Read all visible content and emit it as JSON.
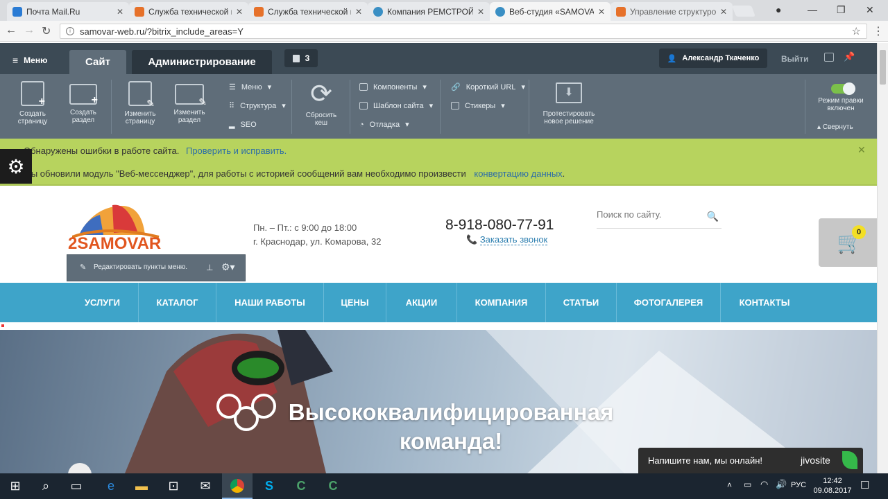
{
  "browser": {
    "tabs": [
      {
        "title": "Почта Mail.Ru",
        "color": "#2a7bd4"
      },
      {
        "title": "Служба технической п",
        "color": "#e6712a"
      },
      {
        "title": "Служба технической п",
        "color": "#e6712a"
      },
      {
        "title": "Компания РЕМСТРОЙ",
        "color": "#3a8fc4"
      },
      {
        "title": "Веб-студия «SAMOVAR",
        "color": "#3a8fc4"
      },
      {
        "title": "Управление структуро",
        "color": "#e6712a"
      }
    ],
    "url": "samovar-web.ru/?bitrix_include_areas=Y"
  },
  "bx": {
    "menu": "Меню",
    "tab_site": "Сайт",
    "tab_admin": "Администрирование",
    "notif_count": "3",
    "user": "Александр Ткаченко",
    "logout": "Выйти",
    "tools": {
      "create_page_1": "Создать",
      "create_page_2": "страницу",
      "create_section_1": "Создать",
      "create_section_2": "раздел",
      "edit_page_1": "Изменить",
      "edit_page_2": "страницу",
      "edit_section_1": "Изменить",
      "edit_section_2": "раздел",
      "menu": "Меню",
      "structure": "Структура",
      "seo": "SEO",
      "reset_1": "Сбросить",
      "reset_2": "кеш",
      "components": "Компоненты",
      "template": "Шаблон сайта",
      "debug": "Отладка",
      "short_url": "Короткий URL",
      "stickers": "Стикеры",
      "test_1": "Протестировать",
      "test_2": "новое решение",
      "edit_mode_1": "Режим правки",
      "edit_mode_2": "включен",
      "collapse": "Свернуть"
    }
  },
  "notices": {
    "n1_text": "Обнаружены ошибки в работе сайта.",
    "n1_link": "Проверить и исправить.",
    "n2_text": "Мы обновили модуль \"Веб-мессенджер\", для работы с историей сообщений вам необходимо произвести",
    "n2_link": "конвертацию данных",
    "n2_end": "."
  },
  "site": {
    "logo": "SAMOVAR",
    "logo_prefix": "2",
    "hours": "Пн. – Пт.: с 9:00 до 18:00",
    "address": "г. Краснодар, ул. Комарова, 32",
    "phone": "8-918-080-77-91",
    "callback": "Заказать звонок",
    "search_placeholder": "Поиск по сайту.",
    "cart_count": "0",
    "menu_edit": "Редактировать пункты меню.",
    "nav": [
      "УСЛУГИ",
      "КАТАЛОГ",
      "НАШИ РАБОТЫ",
      "ЦЕНЫ",
      "АКЦИИ",
      "КОМПАНИЯ",
      "СТАТЬИ",
      "ФОТОГАЛЕРЕЯ",
      "КОНТАКТЫ"
    ],
    "hero_1": "Высококвалифицированная",
    "hero_2": "команда!",
    "chat": "Напишите нам, мы онлайн!",
    "chat_brand": "jivosite"
  },
  "taskbar": {
    "lang": "РУС",
    "time": "12:42",
    "date": "09.08.2017"
  }
}
